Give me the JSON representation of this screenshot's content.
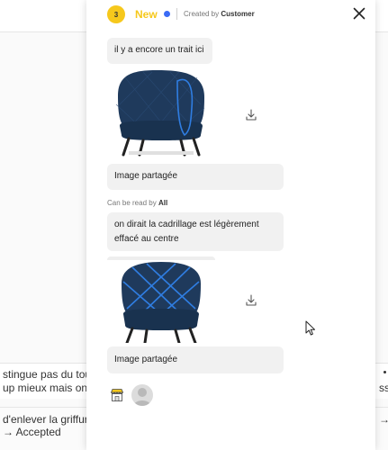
{
  "background": {
    "row1_left_line1": "stingue pas du tout",
    "row1_left_line2": "up mieux mais on c",
    "row1_right_line2": "ss",
    "row2_left_line1": "d'enlever la griffure",
    "row2_left_line2": "→ Accepted",
    "row2_right_line1": "→"
  },
  "drawer": {
    "badge_count": "3",
    "status": "New",
    "created_by_prefix": "Created by",
    "created_by_name": "Customer",
    "messages": [
      {
        "text": "il y a encore un trait ici"
      },
      {
        "text": "Image partagée"
      },
      {
        "text": "on dirait la cadrillage est légèrement effacé au centre"
      },
      {
        "text": "Image partagée"
      }
    ],
    "read_by_prefix": "Can be read by",
    "read_by_value": "All"
  },
  "colors": {
    "status_yellow": "#f6c81c",
    "status_dot": "#3b6bf5",
    "chair_blue": "#1d3557",
    "marker_blue": "#2f7de1"
  },
  "icons": {
    "close": "close-icon",
    "download": "download-icon",
    "shop": "shop-icon",
    "avatar": "user-avatar"
  }
}
